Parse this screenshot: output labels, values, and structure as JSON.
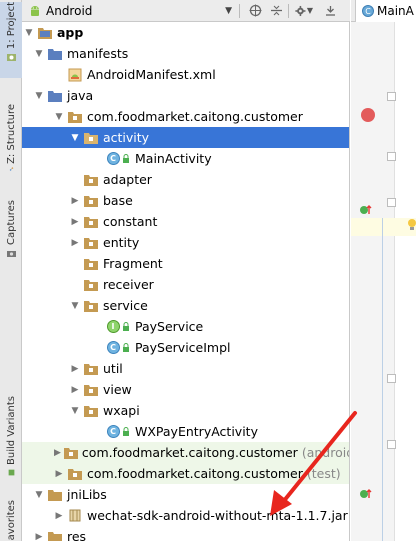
{
  "toolbar": {
    "view_mode": "Android",
    "icons": [
      "android-icon",
      "sync-icon",
      "collapse-icon",
      "settings-icon",
      "hide-icon"
    ]
  },
  "side_tabs": {
    "project": "1: Project",
    "structure": "Z: Structure",
    "captures": "Captures",
    "build_variants": "Build Variants",
    "favorites": "avorites"
  },
  "editor": {
    "tab_label": "MainA"
  },
  "tree": {
    "app": "app",
    "manifests": "manifests",
    "android_manifest": "AndroidManifest.xml",
    "java": "java",
    "pkg_main": "com.foodmarket.caitong.customer",
    "activity": "activity",
    "main_activity": "MainActivity",
    "adapter": "adapter",
    "base": "base",
    "constant": "constant",
    "entity": "entity",
    "fragment": "Fragment",
    "receiver": "receiver",
    "service": "service",
    "pay_service": "PayService",
    "pay_service_impl": "PayServiceImpl",
    "util": "util",
    "view": "view",
    "wxapi": "wxapi",
    "wx_pay_entry": "WXPayEntryActivity",
    "pkg_android_test": "com.foodmarket.caitong.customer",
    "android_test_suffix": "(androidT",
    "pkg_test": "com.foodmarket.caitong.customer",
    "test_suffix": "(test)",
    "jni_libs": "jniLibs",
    "wechat_jar": "wechat-sdk-android-without-mta-1.1.7.jar",
    "res": "res"
  },
  "colors": {
    "selection": "#3875d7",
    "folder": "#c49a52",
    "annotation_arrow": "#e8261e"
  }
}
